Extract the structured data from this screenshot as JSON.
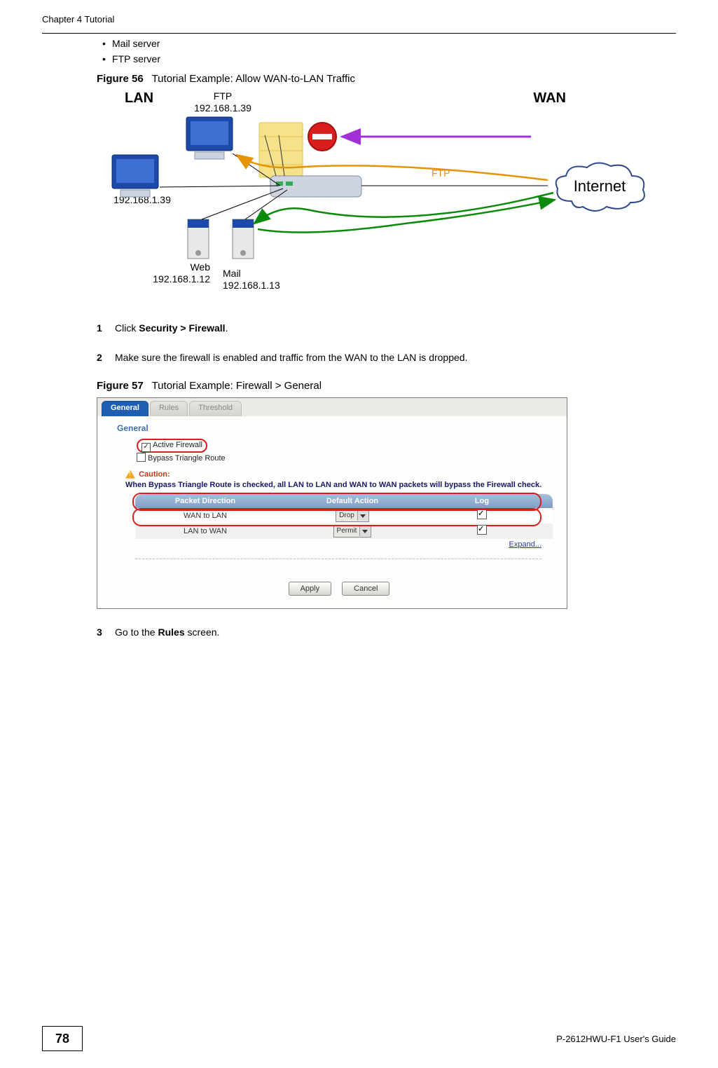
{
  "header": "Chapter 4 Tutorial",
  "bullets": [
    "Mail server",
    "FTP server"
  ],
  "figure56": {
    "num": "Figure 56",
    "title": "Tutorial Example: Allow WAN-to-LAN Traffic"
  },
  "diagram": {
    "lan": "LAN",
    "wan": "WAN",
    "ftp_label": "FTP",
    "ftp_ip": "192.168.1.39",
    "client_ip": "192.168.1.39",
    "web_label": "Web",
    "web_ip": "192.168.1.12",
    "mail_label": "Mail",
    "mail_ip": "192.168.1.13",
    "ftp_arrow": "FTP",
    "internet": "Internet"
  },
  "step1": {
    "num": "1",
    "pre": "Click ",
    "bold": "Security > Firewall",
    "post": "."
  },
  "step2": {
    "num": "2",
    "text": "Make sure the firewall is enabled and traffic from the WAN to the LAN is dropped."
  },
  "figure57": {
    "num": "Figure 57",
    "title": "Tutorial Example: Firewall > General"
  },
  "screenshot": {
    "tabs": [
      "General",
      "Rules",
      "Threshold"
    ],
    "section": "General",
    "cb_active": "Active Firewall",
    "cb_bypass": "Bypass Triangle Route",
    "caution_label": "Caution:",
    "caution_text": "When Bypass Triangle Route is checked, all LAN to LAN and WAN to WAN packets will bypass the Firewall check.",
    "table": {
      "headers": [
        "Packet Direction",
        "Default Action",
        "Log"
      ],
      "rows": [
        {
          "dir": "WAN to LAN",
          "action": "Drop",
          "log": true
        },
        {
          "dir": "LAN to WAN",
          "action": "Permit",
          "log": true
        }
      ]
    },
    "expand": "Expand...",
    "apply": "Apply",
    "cancel": "Cancel"
  },
  "step3": {
    "num": "3",
    "pre": "Go to the ",
    "bold": "Rules",
    "post": " screen."
  },
  "footer": {
    "page": "78",
    "guide": "P-2612HWU-F1 User's Guide"
  }
}
